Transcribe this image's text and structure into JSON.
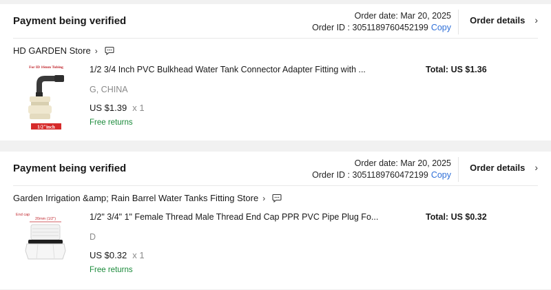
{
  "orders": [
    {
      "status": "Payment being verified",
      "order_date_label": "Order date: Mar 20, 2025",
      "order_id_label": "Order ID : 3051189760452199",
      "copy_label": "Copy",
      "details_label": "Order details",
      "store_name": "HD GARDEN Store",
      "product_title": "1/2 3/4 Inch PVC Bulkhead Water Tank Connector Adapter Fitting with ...",
      "variant": "G, CHINA",
      "price": "US $1.39",
      "quantity": "x 1",
      "returns": "Free returns",
      "total": "Total: US $1.36",
      "image_text_top": "For ID 16mm Tubing",
      "image_text_bottom": "1/2\"inch"
    },
    {
      "status": "Payment being verified",
      "order_date_label": "Order date: Mar 20, 2025",
      "order_id_label": "Order ID : 3051189760472199",
      "copy_label": "Copy",
      "details_label": "Order details",
      "store_name": "Garden Irrigation &amp; Rain Barrel Water Tanks Fitting Store",
      "product_title": "1/2\" 3/4\" 1\" Female Thread Male Thread End Cap PPR PVC Pipe Plug Fo...",
      "variant": "D",
      "price": "US $0.32",
      "quantity": "x 1",
      "returns": "Free returns",
      "total": "Total: US $0.32",
      "image_text_top": "End cap",
      "image_text_dim": "20mm (1/2\")"
    }
  ],
  "icons": {
    "chevron": "chevron-right-icon",
    "chat": "chat-bubble-icon"
  },
  "colors": {
    "link": "#2e6fd8",
    "returns": "#1a8a3a",
    "muted": "#8a8a8a"
  }
}
